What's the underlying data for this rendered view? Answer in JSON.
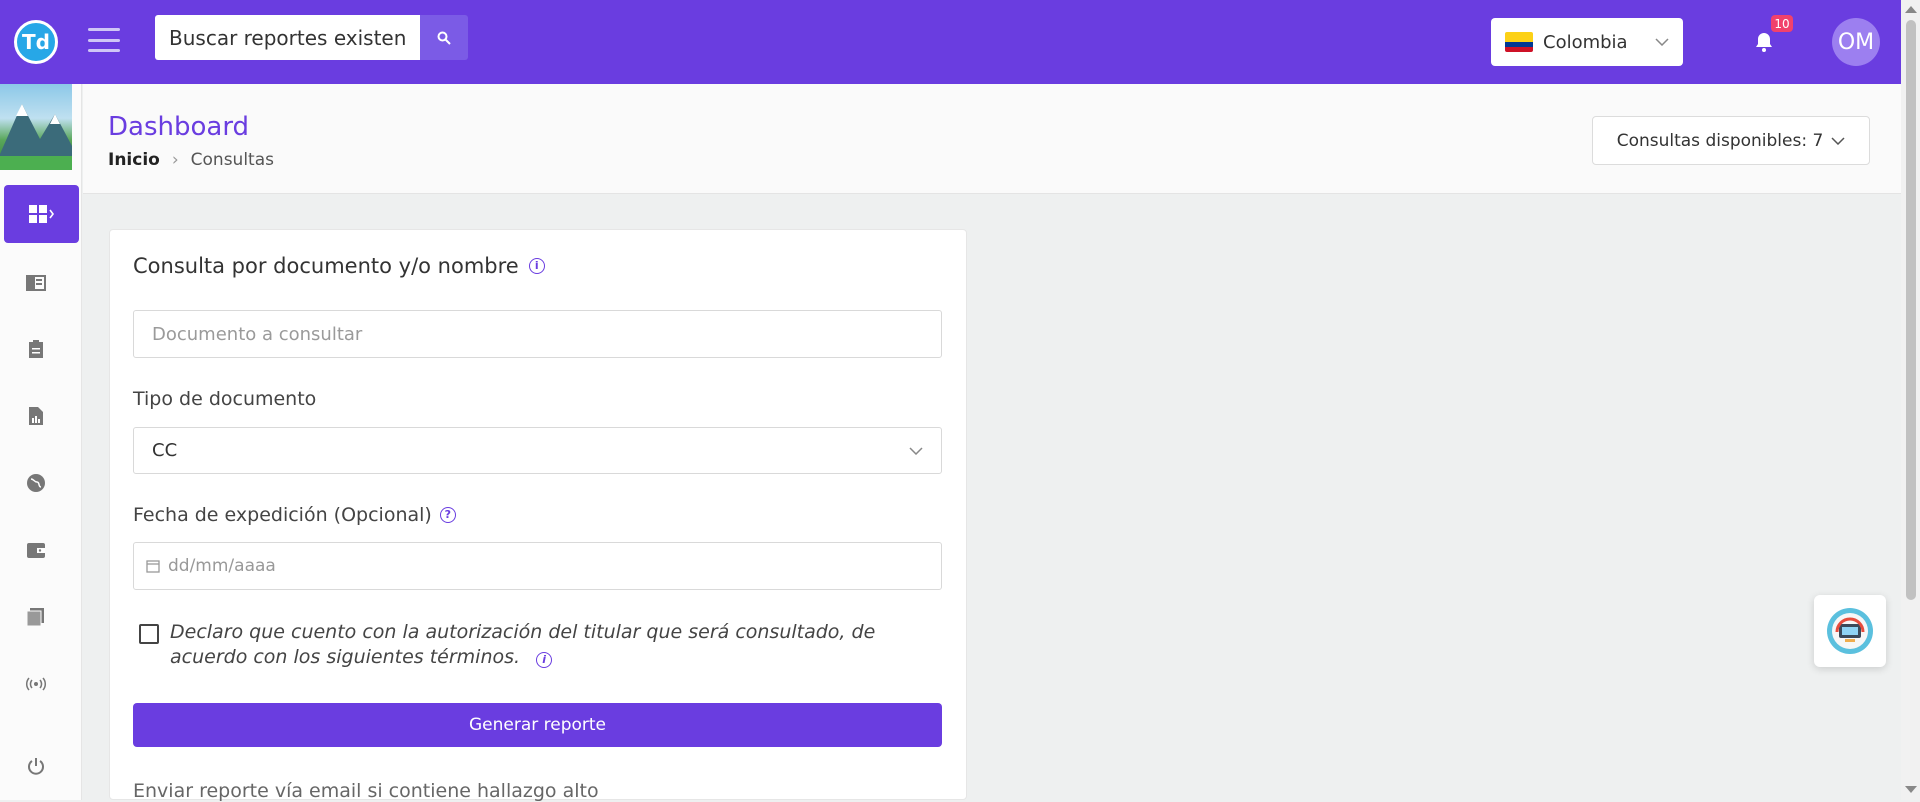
{
  "topbar": {
    "logo_text": "Td",
    "search_placeholder": "Buscar reportes existentes",
    "search_value": "Buscar reportes existent",
    "country": "Colombia",
    "notifications_count": "10",
    "avatar_initials": "OM",
    "accent_color": "#6a3de0"
  },
  "sidebar": {
    "items": [
      {
        "icon": "dashboard-icon",
        "active": true
      },
      {
        "icon": "book-icon"
      },
      {
        "icon": "clipboard-icon"
      },
      {
        "icon": "report-file-icon"
      },
      {
        "icon": "globe-icon"
      },
      {
        "icon": "wallet-icon"
      },
      {
        "icon": "documents-icon"
      },
      {
        "icon": "broadcast-icon"
      },
      {
        "icon": "power-icon"
      }
    ]
  },
  "header": {
    "title": "Dashboard",
    "breadcrumb_home": "Inicio",
    "breadcrumb_current": "Consultas",
    "consultas_label": "Consultas disponibles: 7"
  },
  "form": {
    "title": "Consulta por documento y/o nombre",
    "doc_placeholder": "Documento a consultar",
    "tipo_label": "Tipo de documento",
    "tipo_value": "CC",
    "fecha_label": "Fecha de expedición (Opcional)",
    "fecha_placeholder": "dd/mm/aaaa",
    "declaration": "Declaro que cuento con la autorización del titular que será consultado, de acuerdo con los siguientes términos.",
    "submit_label": "Generar reporte",
    "email_label": "Enviar reporte vía email si contiene hallazgo alto"
  }
}
